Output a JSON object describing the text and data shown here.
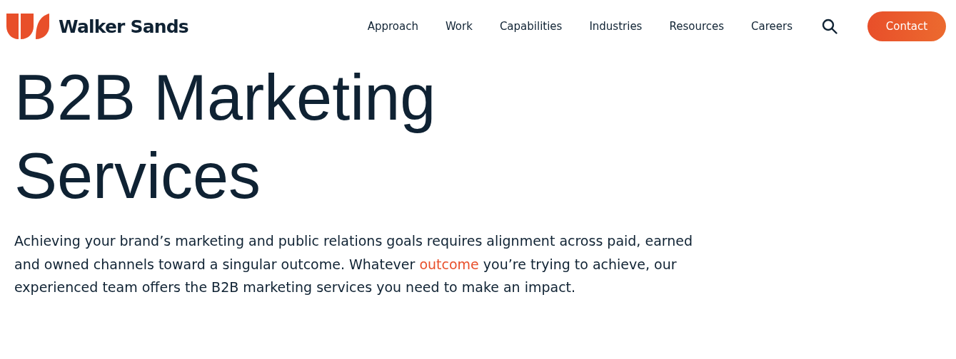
{
  "header": {
    "brand": "Walker Sands",
    "nav": [
      {
        "label": "Approach"
      },
      {
        "label": "Work"
      },
      {
        "label": "Capabilities"
      },
      {
        "label": "Industries"
      },
      {
        "label": "Resources"
      },
      {
        "label": "Careers"
      }
    ],
    "cta": "Contact"
  },
  "hero": {
    "title_lines": [
      "B2B Marketing",
      "Services"
    ],
    "intro": {
      "before": "Achieving your brand’s marketing and public relations goals requires alignment across paid, earned and owned channels toward a singular outcome. Whatever ",
      "link": "outcome",
      "after": " you’re trying to achieve, our experienced team offers the B2B marketing services you need to make an impact."
    }
  }
}
